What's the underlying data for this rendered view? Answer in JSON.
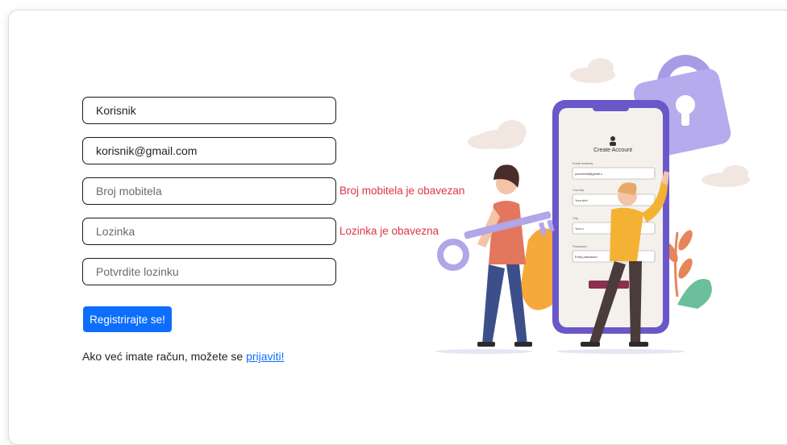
{
  "form": {
    "username_value": "Korisnik",
    "email_value": "korisnik@gmail.com",
    "phone_placeholder": "Broj mobitela",
    "phone_error": "Broj mobitela je obavezan",
    "password_placeholder": "Lozinka",
    "password_error": "Lozinka je obavezna",
    "confirm_placeholder": "Potvrdite lozinku",
    "submit_label": "Registrirajte se!"
  },
  "footer": {
    "text": "Ako već imate račun, možete se ",
    "link_label": "prijaviti!"
  },
  "illustration": {
    "phone_title": "Create Account",
    "labels": [
      "Email address",
      "Country",
      "City",
      "Password"
    ],
    "values": [
      "youremail@gmail.c",
      "Your text",
      "Your c",
      "Entry password"
    ]
  },
  "colors": {
    "accent": "#0d6efd",
    "error": "#dc3545"
  }
}
